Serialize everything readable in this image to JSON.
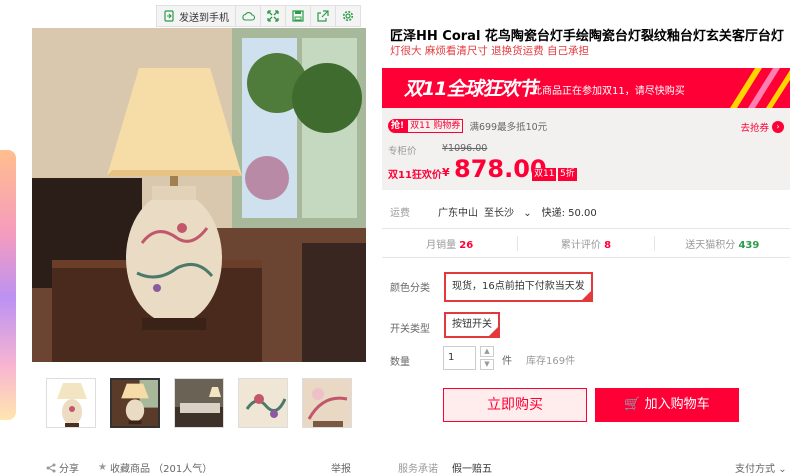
{
  "toolbar": {
    "send_to_phone": "发送到手机",
    "icons": [
      "phone-send-icon",
      "cloud-icon",
      "expand-icon",
      "save-icon",
      "share-out-icon",
      "gear-icon"
    ]
  },
  "product": {
    "title": "匠泽HH Coral 花鸟陶瓷台灯手绘陶瓷台灯裂纹釉台灯玄关客厅台灯",
    "subtitle": "灯很大 麻烦看清尺寸 退换货运费 自己承担"
  },
  "promo": {
    "banner_title": "双11全球狂欢节",
    "banner_text": "此商品正在参加双11，请尽快购买"
  },
  "coupon": {
    "grab": "抢!",
    "badge": "双11 购物券",
    "desc": "满699最多抵10元",
    "link": "去抢券"
  },
  "price": {
    "orig_label": "专柜价",
    "orig_value": "¥1096.00",
    "promo_label": "双11狂欢价",
    "currency": "¥",
    "value": "878.00",
    "tag1": "双11",
    "tag2": "5折"
  },
  "shipping": {
    "label": "运费",
    "from": "广东中山",
    "to": "至长沙",
    "fee": "快递: 50.00"
  },
  "stats": [
    {
      "label": "月销量",
      "value": "26"
    },
    {
      "label": "累计评价",
      "value": "8"
    },
    {
      "label": "送天猫积分",
      "value": "439"
    }
  ],
  "options": {
    "color_label": "颜色分类",
    "color_value": "现货，16点前拍下付款当天发",
    "switch_label": "开关类型",
    "switch_value": "按钮开关"
  },
  "quantity": {
    "label": "数量",
    "value": "1",
    "unit": "件",
    "stock": "库存169件"
  },
  "buttons": {
    "buy": "立即购买",
    "cart": "加入购物车"
  },
  "bottom": {
    "share": "分享",
    "favorite": "收藏商品 （201人气）",
    "report": "举报",
    "service_label": "服务承诺",
    "service_value": "假一赔五",
    "payment": "支付方式"
  },
  "colors": {
    "accent": "#ff0036",
    "toolbar_icon": "#2c9c4a"
  }
}
